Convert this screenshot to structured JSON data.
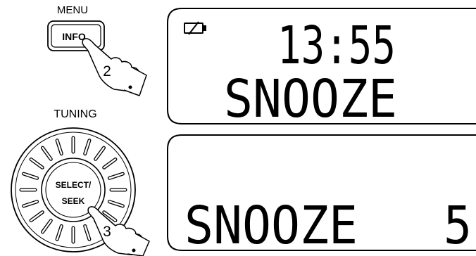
{
  "controls": {
    "menu_label": "MENU",
    "info_button": "INFO",
    "step_info": "2",
    "tuning_label": "TUNING",
    "select_line1": "SELECT/",
    "select_line2": "SEEK",
    "step_select": "3"
  },
  "display_top": {
    "time": "13:55",
    "line2": "SNOOZE",
    "icon": "battery-icon"
  },
  "display_bottom": {
    "line1": "",
    "line2_text": "SNOOZE",
    "line2_value": "5"
  }
}
